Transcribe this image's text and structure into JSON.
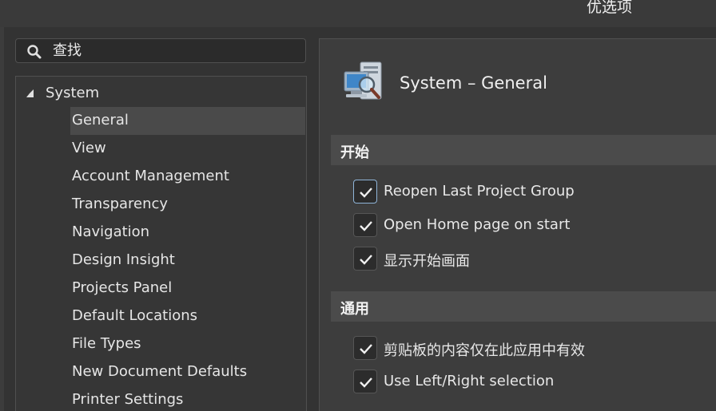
{
  "window": {
    "title": "优选项"
  },
  "search": {
    "placeholder": "查找"
  },
  "tree": {
    "root_label": "System",
    "items": [
      {
        "label": "General",
        "selected": true
      },
      {
        "label": "View"
      },
      {
        "label": "Account Management"
      },
      {
        "label": "Transparency"
      },
      {
        "label": "Navigation"
      },
      {
        "label": "Design Insight"
      },
      {
        "label": "Projects Panel"
      },
      {
        "label": "Default Locations"
      },
      {
        "label": "File Types"
      },
      {
        "label": "New Document Defaults"
      },
      {
        "label": "Printer Settings"
      }
    ]
  },
  "main": {
    "header_icon": "computer-settings-icon",
    "title": "System – General",
    "sections": [
      {
        "title": "开始",
        "options": [
          {
            "label": "Reopen Last Project Group",
            "checked": true
          },
          {
            "label": "Open Home page on start",
            "checked": true
          },
          {
            "label": "显示开始画面",
            "checked": true
          }
        ]
      },
      {
        "title": "通用",
        "options": [
          {
            "label": "剪贴板的内容仅在此应用中有效",
            "checked": true
          },
          {
            "label": "Use Left/Right selection",
            "checked": true
          }
        ]
      }
    ]
  },
  "colors": {
    "background": "#3c3c3c",
    "panel": "#363636",
    "selection": "#4a4a4a",
    "section_header": "#4b4b4b",
    "focus_border": "#8fb4d8"
  }
}
